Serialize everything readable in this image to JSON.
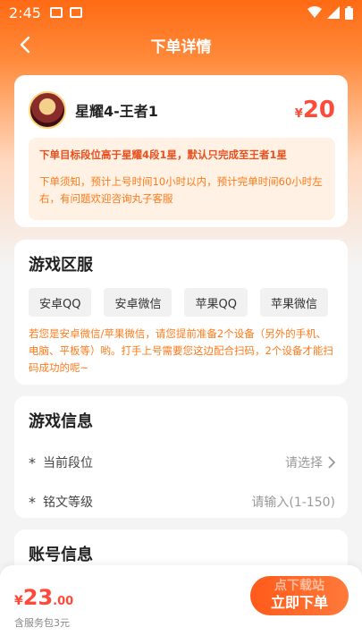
{
  "status_bar": {
    "time": "2:45"
  },
  "nav": {
    "title": "下单详情"
  },
  "order": {
    "name": "星耀4-王者1",
    "currency": "¥",
    "price": "20",
    "warning": "下单目标段位高于星耀4段1星，默认只完成至王者1星",
    "tip": "下单须知，预计上号时间10小时以内，预计完单时间60小时左右，有问题欢迎咨询丸子客服"
  },
  "region": {
    "title": "游戏区服",
    "options": [
      "安卓QQ",
      "安卓微信",
      "苹果QQ",
      "苹果微信"
    ],
    "note": "若您是安卓微信/苹果微信，请您提前准备2个设备（另外的手机、电脑、平板等）哟。打手上号需要您这边配合扫码，2个设备才能扫码成功的呢~"
  },
  "game_info": {
    "title": "游戏信息",
    "rank_label": "当前段位",
    "rank_placeholder": "请选择",
    "inscription_label": "铭文等级",
    "inscription_placeholder": "请输入(1-150)",
    "required_mark": "*"
  },
  "account": {
    "title": "账号信息"
  },
  "bottom": {
    "currency": "¥",
    "total_int": "23",
    "total_dec": ".00",
    "fee_note": "含服务包3元",
    "ghost_label": "点下载站",
    "order_button": "立即下单"
  },
  "colors": {
    "accent": "#ff6a14",
    "price": "#ff4a3a",
    "tip": "#ff7a1a"
  }
}
